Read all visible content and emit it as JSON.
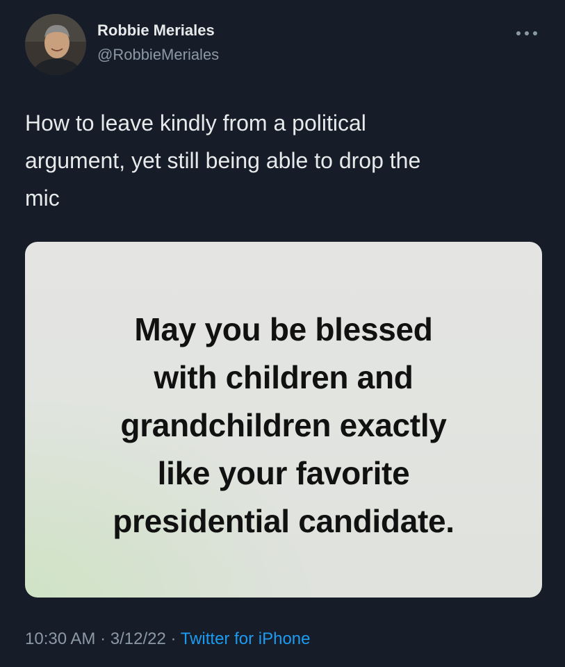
{
  "author": {
    "name": "Robbie Meriales",
    "handle": "@RobbieMeriales",
    "avatar_icon": "person-photo"
  },
  "tweet": {
    "text": "How to leave kindly from a political\nargument, yet still being able to drop the\nmic",
    "media_text": "May you be blessed\nwith children and\ngrandchildren exactly\nlike your favorite\npresidential candidate."
  },
  "meta": {
    "time": "10:30 AM",
    "separator": "·",
    "date": "3/12/22",
    "source": "Twitter for iPhone"
  },
  "colors": {
    "background": "#161c28",
    "primary_text": "#e7e9ea",
    "secondary_text": "#8b98a5",
    "accent": "#1d9bf0"
  },
  "icons": {
    "more": "more-horizontal-icon"
  }
}
